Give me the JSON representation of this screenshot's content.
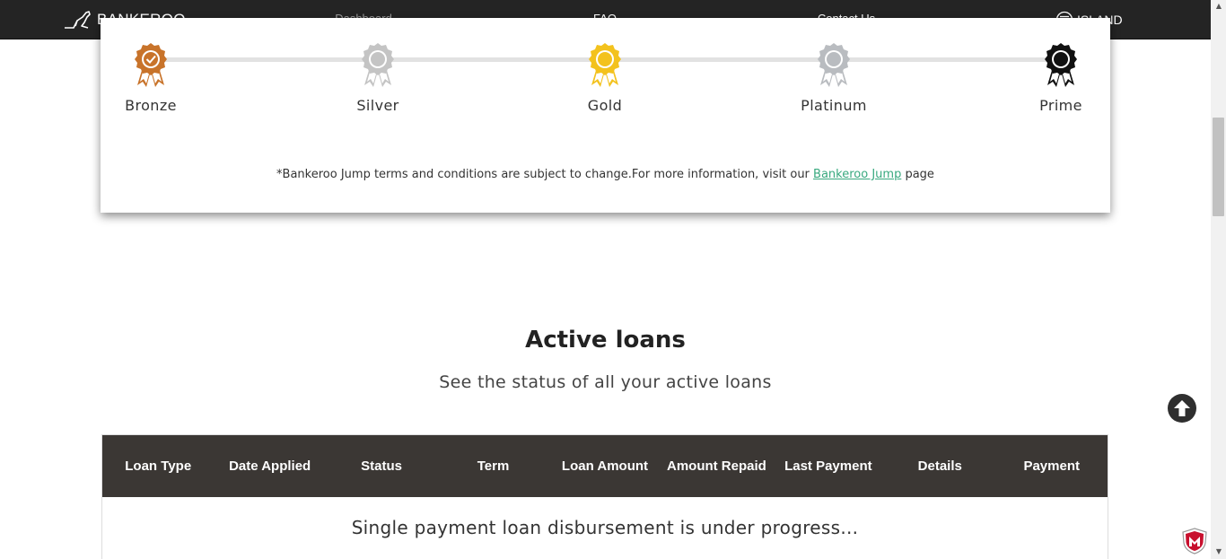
{
  "nav": {
    "brand": "BANKEROO",
    "links": [
      "Dashboard",
      "FAQ",
      "Contact Us"
    ],
    "language": "ISLAND"
  },
  "tiers": {
    "items": [
      {
        "label": "Bronze",
        "color": "#c8732a"
      },
      {
        "label": "Silver",
        "color": "#c4c4c4"
      },
      {
        "label": "Gold",
        "color": "#f3c21d"
      },
      {
        "label": "Platinum",
        "color": "#b9bcc0"
      },
      {
        "label": "Prime",
        "color": "#111111"
      }
    ],
    "terms_prefix": "*Bankeroo Jump terms and conditions are subject to change.For more information, visit our ",
    "terms_link": "Bankeroo Jump",
    "terms_suffix": " page"
  },
  "loans": {
    "title": "Active loans",
    "subtitle": "See the status of all your active loans",
    "columns": [
      "Loan Type",
      "Date Applied",
      "Status",
      "Term",
      "Loan Amount",
      "Amount Repaid",
      "Last Payment",
      "Details",
      "Payment"
    ],
    "message": "Single payment loan disbursement is under progress..."
  }
}
